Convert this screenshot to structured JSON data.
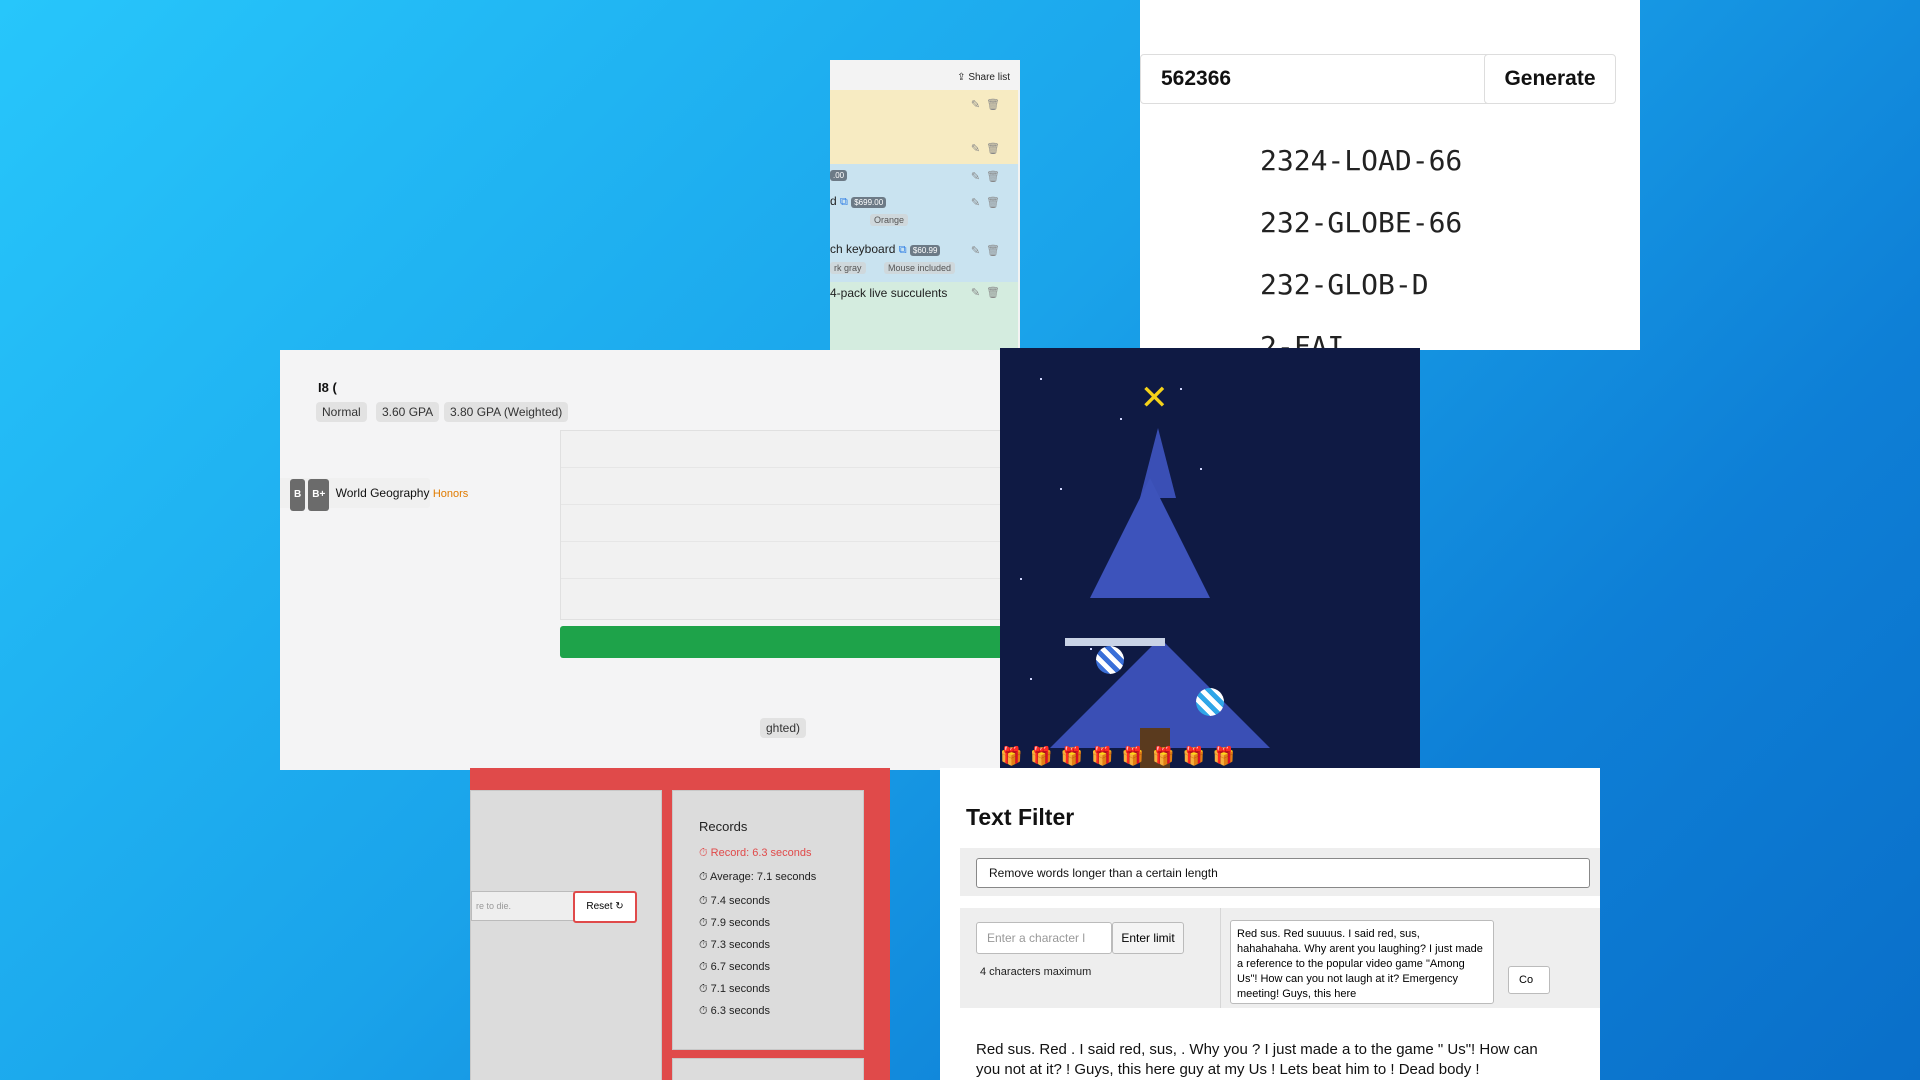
{
  "shopping_list": {
    "share_label": "Share list",
    "items": [
      {
        "name": "d",
        "price": "$699.00",
        "tags": [
          "Orange"
        ]
      },
      {
        "name": "ch keyboard",
        "price": "$60.99",
        "tags": [
          "rk gray",
          "Mouse included"
        ]
      },
      {
        "name": "4-pack live succulents"
      }
    ],
    "partial_price": ".00"
  },
  "code_generator": {
    "input_value": "562366",
    "generate_label": "Generate",
    "codes": [
      "2324-LOAD-66",
      "232-GLOBE-66",
      "232-GLOB-D",
      "2-FAI"
    ]
  },
  "gpa_calculator": {
    "header_partial": "I8 (",
    "badges": [
      "Normal",
      "3.60 GPA",
      "3.80 GPA (Weighted)"
    ],
    "rows": [
      {
        "grades": [],
        "course": "",
        "level": ""
      },
      {
        "grades": [
          "B",
          "B+"
        ],
        "course": "World Geography",
        "level": "Honors"
      },
      {
        "grades": [],
        "course": "",
        "level": ""
      },
      {
        "grades": [],
        "course": "",
        "level": ""
      },
      {
        "grades": [],
        "course": "",
        "level": ""
      }
    ],
    "second_badge_partial": "ghted)"
  },
  "reaction_timer": {
    "input_placeholder": "re to die.",
    "reset_label": "Reset",
    "records_title": "Records",
    "record_best": "Record: 6.3 seconds",
    "average": "Average: 7.1 seconds",
    "times": [
      "7.4 seconds",
      "7.9 seconds",
      "7.3 seconds",
      "6.7 seconds",
      "7.1 seconds",
      "6.3 seconds"
    ],
    "accent_color": "#e04a4a"
  },
  "text_filter": {
    "title": "Text Filter",
    "mode": "Remove words longer than a certain length",
    "char_placeholder": "Enter a character l",
    "limit_button": "Enter limit",
    "limit_note": "4 characters maximum",
    "input_text": "Red sus. Red suuuus. I said red, sus, hahahahaha. Why arent you laughing? I just made a reference to the popular video game \"Among Us\"! How can you not laugh at it? Emergency meeting! Guys, this here",
    "side_button": "Co",
    "output_text": "Red sus. Red . I said red, sus, . Why you ? I just made a to the game \" Us\"! How can you not at it? ! Guys, this here guy at my Us ! Lets beat him to ! Dead body !"
  },
  "colors": {
    "background_start": "#27c6fb",
    "background_end": "#0a6fc9",
    "progress_green": "#1ea34a",
    "honors_orange": "#e07b00"
  }
}
